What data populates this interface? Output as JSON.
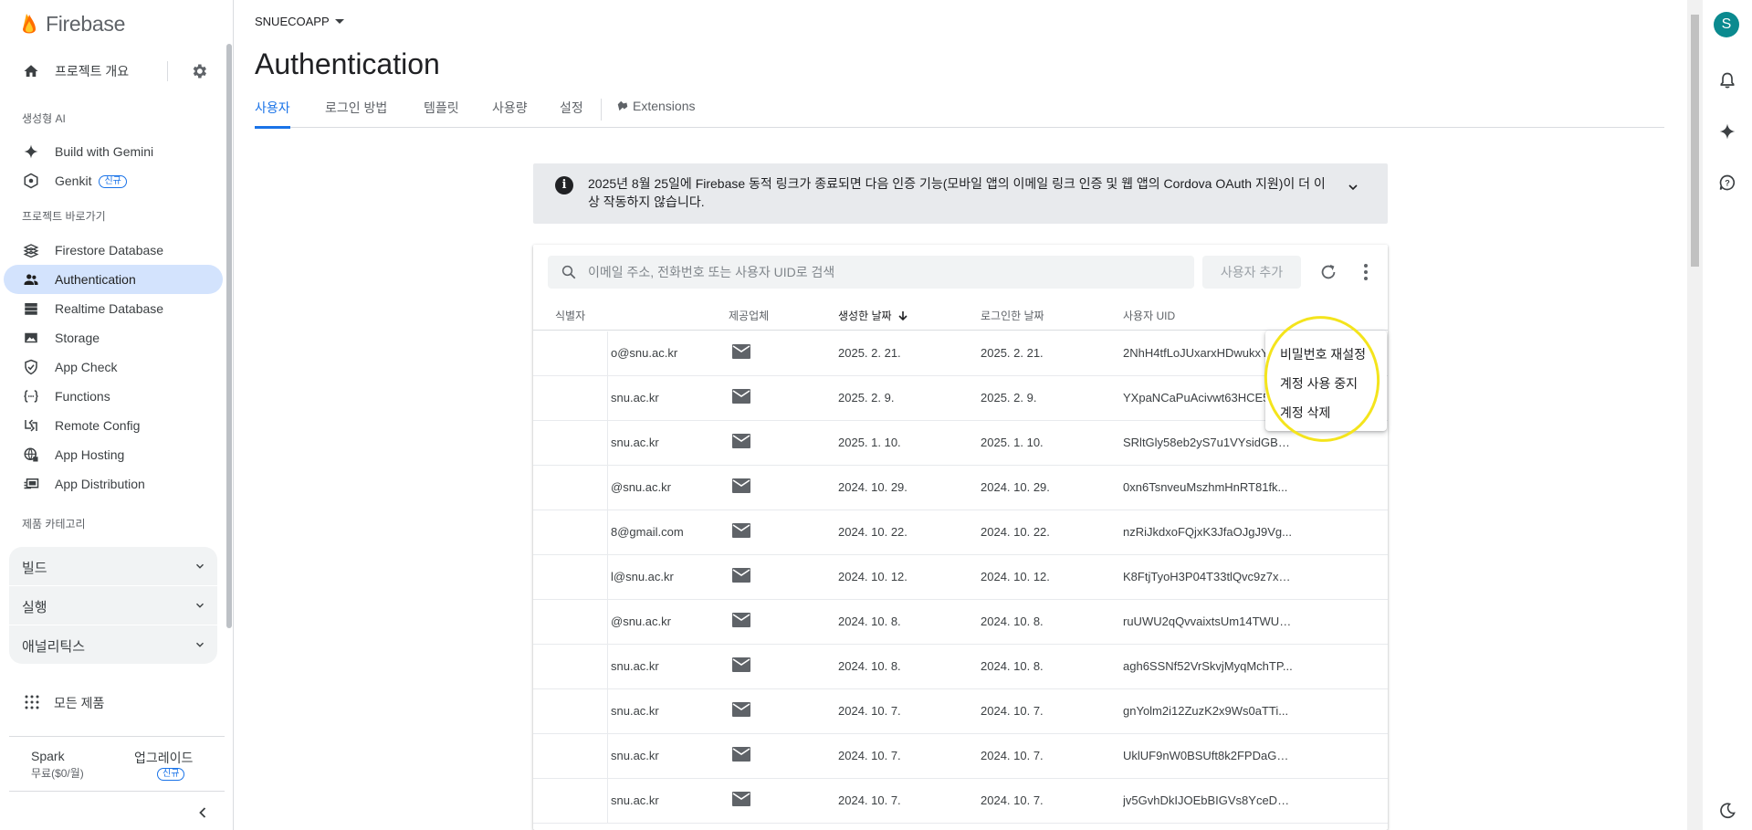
{
  "brand": {
    "name": "Firebase"
  },
  "sidebar": {
    "overview_label": "프로젝트 개요",
    "section_genai": "생성형 AI",
    "genai_items": [
      {
        "label": "Build with Gemini",
        "icon": "sparkle-icon"
      },
      {
        "label": "Genkit",
        "icon": "genkit-icon",
        "badge": "신규"
      }
    ],
    "section_shortcuts": "프로젝트 바로가기",
    "shortcut_items": [
      {
        "label": "Firestore Database",
        "icon": "firestore-icon"
      },
      {
        "label": "Authentication",
        "icon": "people-icon",
        "active": true
      },
      {
        "label": "Realtime Database",
        "icon": "realtime-db-icon"
      },
      {
        "label": "Storage",
        "icon": "image-icon"
      },
      {
        "label": "App Check",
        "icon": "shield-icon"
      },
      {
        "label": "Functions",
        "icon": "functions-icon"
      },
      {
        "label": "Remote Config",
        "icon": "remote-config-icon"
      },
      {
        "label": "App Hosting",
        "icon": "globe-icon"
      },
      {
        "label": "App Distribution",
        "icon": "app-distribution-icon"
      }
    ],
    "section_categories": "제품 카테고리",
    "categories": [
      "빌드",
      "실행",
      "애널리틱스"
    ],
    "all_products": "모든 제품",
    "plan_name": "Spark",
    "plan_price": "무료($0/월)",
    "upgrade_label": "업그레이드",
    "upgrade_badge": "신규"
  },
  "header": {
    "project_name": "SNUECOAPP",
    "page_title": "Authentication"
  },
  "tabs": [
    "사용자",
    "로그인 방법",
    "템플릿",
    "사용량",
    "설정",
    "Extensions"
  ],
  "notice": {
    "text": "2025년 8월 25일에 Firebase 동적 링크가 종료되면 다음 인증 기능(모바일 앱의 이메일 링크 인증 및 웹 앱의 Cordova OAuth 지원)이 더 이상 작동하지 않습니다."
  },
  "users_table": {
    "search_placeholder": "이메일 주소, 전화번호 또는 사용자 UID로 검색",
    "add_user_label": "사용자 추가",
    "columns": [
      "식별자",
      "제공업체",
      "생성한 날짜",
      "로그인한 날짜",
      "사용자 UID"
    ],
    "rows": [
      {
        "email": "o@snu.ac.kr",
        "created": "2025. 2. 21.",
        "signed_in": "2025. 2. 21.",
        "uid": "2NhH4tfLoJUxarxHDwukxYyz"
      },
      {
        "email": "snu.ac.kr",
        "created": "2025. 2. 9.",
        "signed_in": "2025. 2. 9.",
        "uid": "YXpaNCaPuAcivwt63HCE5..."
      },
      {
        "email": "snu.ac.kr",
        "created": "2025. 1. 10.",
        "signed_in": "2025. 1. 10.",
        "uid": "SRltGly58eb2yS7u1VYsidGBk2..."
      },
      {
        "email": "@snu.ac.kr",
        "created": "2024. 10. 29.",
        "signed_in": "2024. 10. 29.",
        "uid": "0xn6TsnveuMszhmHnRT81fk..."
      },
      {
        "email": "8@gmail.com",
        "created": "2024. 10. 22.",
        "signed_in": "2024. 10. 22.",
        "uid": "nzRiJkdxoFQjxK3JfaOJgJ9Vg..."
      },
      {
        "email": "l@snu.ac.kr",
        "created": "2024. 10. 12.",
        "signed_in": "2024. 10. 12.",
        "uid": "K8FtjTyoH3P04T33tlQvc9z7xd..."
      },
      {
        "email": "@snu.ac.kr",
        "created": "2024. 10. 8.",
        "signed_in": "2024. 10. 8.",
        "uid": "ruUWU2qQvvaixtsUm14TWUn..."
      },
      {
        "email": "snu.ac.kr",
        "created": "2024. 10. 8.",
        "signed_in": "2024. 10. 8.",
        "uid": "agh6SSNf52VrSkvjMyqMchTP..."
      },
      {
        "email": "snu.ac.kr",
        "created": "2024. 10. 7.",
        "signed_in": "2024. 10. 7.",
        "uid": "gnYolm2i12ZuzK2x9Ws0aTTi..."
      },
      {
        "email": "snu.ac.kr",
        "created": "2024. 10. 7.",
        "signed_in": "2024. 10. 7.",
        "uid": "UklUF9nW0BSUft8k2FPDaGQ..."
      },
      {
        "email": "snu.ac.kr",
        "created": "2024. 10. 7.",
        "signed_in": "2024. 10. 7.",
        "uid": "jv5GvhDkIJOEbBIGVs8YceDSK..."
      }
    ]
  },
  "context_menu": {
    "items": [
      "비밀번호 재설정",
      "계정 사용 중지",
      "계정 삭제"
    ]
  },
  "user": {
    "avatar_letter": "S"
  },
  "colors": {
    "accent": "#1a73e8",
    "active_nav_bg": "#d3e3fd",
    "annotation": "#f4e41c",
    "avatar": "#0b8a8f"
  }
}
